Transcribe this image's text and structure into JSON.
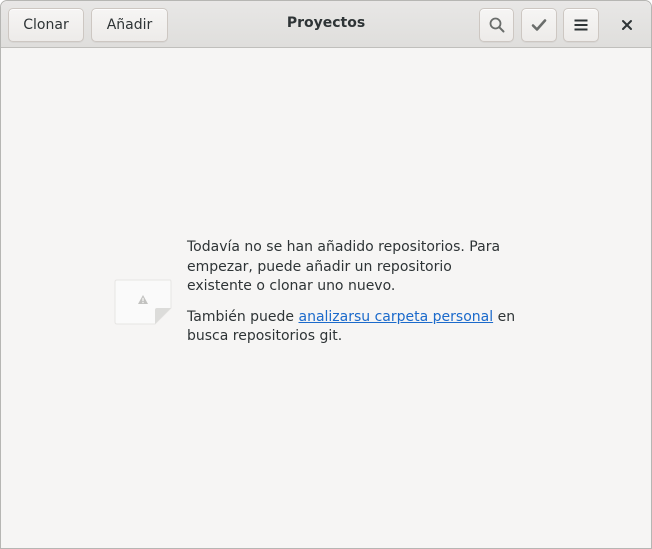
{
  "header": {
    "clone_label": "Clonar",
    "add_label": "Añadir",
    "title": "Proyectos",
    "search_icon": "search-icon",
    "select_icon": "checkmark-icon",
    "menu_icon": "hamburger-menu-icon",
    "close_icon": "close-icon"
  },
  "empty_state": {
    "icon": "document-warning-icon",
    "message": "Todavía no se han añadido repositorios. Para empezar, puede añadir un repositorio existente o clonar uno nuevo.",
    "scan_prefix": "También puede ",
    "scan_link": "analizarsu carpeta personal",
    "scan_suffix": " en busca repositorios git."
  },
  "colors": {
    "link": "#1b6acb",
    "text": "#2e3436",
    "background": "#f6f5f4"
  }
}
